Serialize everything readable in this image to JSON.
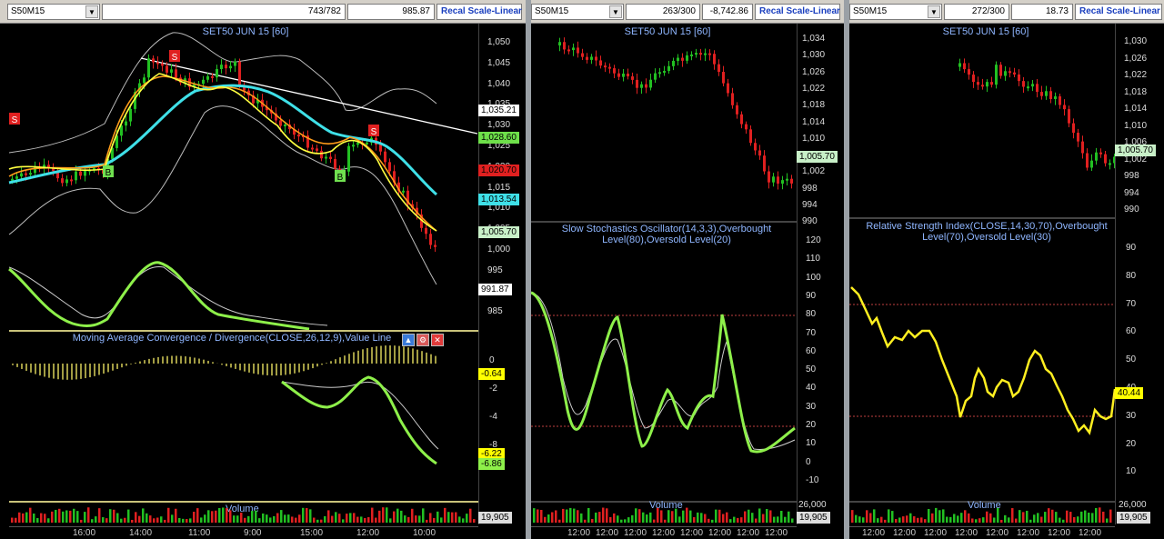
{
  "panes": [
    {
      "symbol": "S50M15",
      "counter": "743/782",
      "last": "985.87",
      "recal": "Recal Scale-Linear",
      "title": "SET50 JUN 15   [60]",
      "price_ticks": [
        "1,050",
        "1,045",
        "1,040",
        "1,035",
        "1,030",
        "1,025",
        "1,020",
        "1,015",
        "1,010",
        "1,005",
        "1,000",
        "995",
        "990",
        "985"
      ],
      "tags": [
        {
          "text": "1,035.21",
          "color": "#ffffff"
        },
        {
          "text": "1,028.60",
          "color": "#6ee04a"
        },
        {
          "text": "1,020.70",
          "color": "#e02020"
        },
        {
          "text": "1,013.54",
          "color": "#3fe0e8"
        },
        {
          "text": "1,005.70",
          "color": "#c8f0c8"
        },
        {
          "text": "991.87",
          "color": "#ffffff"
        }
      ],
      "markers": [
        "S",
        "S",
        "B",
        "B",
        "S"
      ],
      "macd_title": "Moving Average Convergence / Divergence(CLOSE,26,12,9),Value Line",
      "macd_ticks": [
        "0",
        "-2",
        "-4",
        "-8"
      ],
      "macd_tags": [
        {
          "text": "-0.64",
          "color": "#ffff00"
        },
        {
          "text": "-6.22",
          "color": "#ffff00"
        },
        {
          "text": "-6.86",
          "color": "#8ef04a"
        }
      ],
      "volume_title": "Volume",
      "volume_tag": "19,905",
      "time_labels": [
        "16:00",
        "14:00",
        "11:00",
        "9:00",
        "15:00",
        "12:00",
        "10:00"
      ]
    },
    {
      "symbol": "S50M15",
      "counter": "263/300",
      "last": "-8,742.86",
      "recal": "Recal Scale-Linear",
      "title": "SET50 JUN 15   [60]",
      "price_ticks": [
        "1,034",
        "1,030",
        "1,026",
        "1,022",
        "1,018",
        "1,014",
        "1,010",
        "1,006",
        "1,002",
        "998",
        "994",
        "990"
      ],
      "tags": [
        {
          "text": "1,005.70",
          "color": "#c8f0c8"
        }
      ],
      "osc_title": "Slow Stochastics Oscillator(14,3,3),Overbought Level(80),Oversold Level(20)",
      "osc_ticks": [
        "120",
        "110",
        "100",
        "90",
        "80",
        "70",
        "60",
        "50",
        "40",
        "30",
        "20",
        "10",
        "0",
        "-10"
      ],
      "volume_title": "Volume",
      "volume_top_tick": "26,000",
      "volume_tag": "19,905",
      "time_labels": [
        "12:00",
        "12:00",
        "12:00",
        "12:00",
        "12:00",
        "12:00",
        "12:00",
        "12:00"
      ]
    },
    {
      "symbol": "S50M15",
      "counter": "272/300",
      "last": "18.73",
      "recal": "Recal Scale-Linear",
      "title": "SET50 JUN 15   [60]",
      "price_ticks": [
        "1,030",
        "1,026",
        "1,022",
        "1,018",
        "1,014",
        "1,010",
        "1,006",
        "1,002",
        "998",
        "994",
        "990"
      ],
      "tags": [
        {
          "text": "1,005.70",
          "color": "#c8f0c8"
        }
      ],
      "osc_title": "Relative Strength Index(CLOSE,14,30,70),Overbought Level(70),Oversold Level(30)",
      "osc_ticks": [
        "90",
        "80",
        "70",
        "60",
        "50",
        "40",
        "30",
        "20",
        "10"
      ],
      "osc_tag": "40.44",
      "volume_title": "Volume",
      "volume_top_tick": "26,000",
      "volume_tag": "19,905",
      "time_labels": [
        "12:00",
        "12:00",
        "12:00",
        "12:00",
        "12:00",
        "12:00",
        "12:00",
        "12:00"
      ]
    }
  ],
  "colors": {
    "up_candle": "#22c022",
    "down_candle": "#e02020",
    "bollinger": "#bdbdbd",
    "ma_fast": "#ffff40",
    "ma_mid": "#ff9c1a",
    "ma_slow": "#3fe0e8",
    "macd_line": "#8ef04a",
    "signal_line": "#cccccc",
    "histogram": "#e8e060",
    "title_blue": "#8fb6ff",
    "level_line": "#c04040"
  },
  "icons": [
    "dropdown-arrow-icon",
    "move-up-icon",
    "settings-icon",
    "close-icon"
  ]
}
